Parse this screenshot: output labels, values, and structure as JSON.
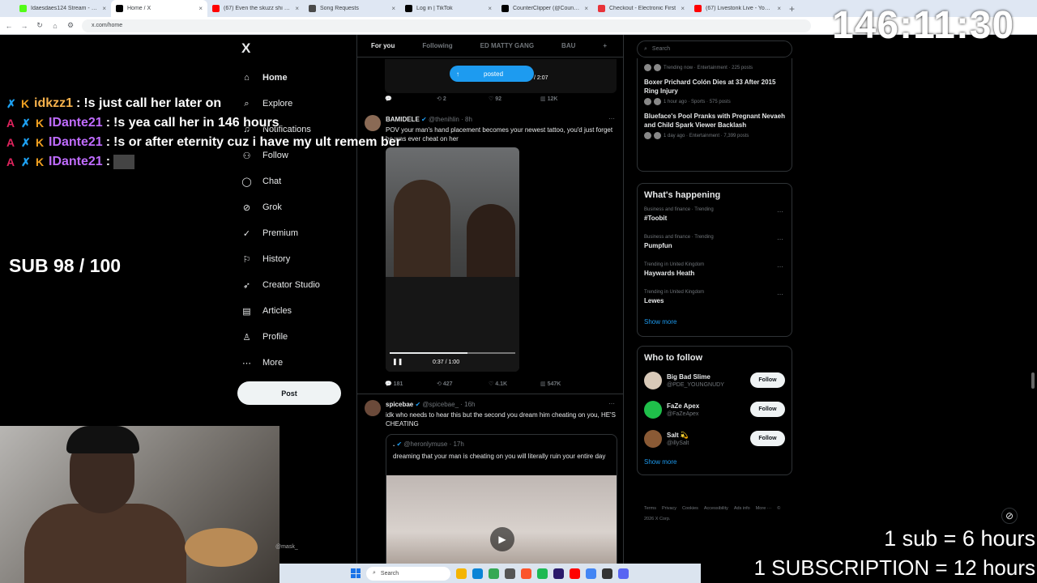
{
  "browser": {
    "tabs": [
      {
        "label": "Idaesdaes124 Stream - Watch Live",
        "color": "#53fc18",
        "active": false
      },
      {
        "label": "Home / X",
        "color": "#000000",
        "active": true
      },
      {
        "label": "(67) Even the skuzz shi goin",
        "color": "#ff0000",
        "active": false
      },
      {
        "label": "Song Requests",
        "color": "#4a4a4a",
        "active": false
      },
      {
        "label": "Log in | TikTok",
        "color": "#000000",
        "active": false
      },
      {
        "label": "CounterClipper (@CounterClip...",
        "color": "#000000",
        "active": false
      },
      {
        "label": "Checkout - Electronic First",
        "color": "#e8333a",
        "active": false
      },
      {
        "label": "(67) Livestonk Live - YouTube",
        "color": "#ff0000",
        "active": false
      }
    ],
    "new_tab": "+",
    "url": "x.com/home"
  },
  "nav": {
    "logo": "X",
    "items": [
      {
        "label": "Home",
        "icon": "home-icon",
        "glyph": "⌂",
        "active": true
      },
      {
        "label": "Explore",
        "icon": "search-icon",
        "glyph": "⌕",
        "active": false
      },
      {
        "label": "Notifications",
        "icon": "bell-icon",
        "glyph": "♫",
        "active": false
      },
      {
        "label": "Follow",
        "icon": "person-plus-icon",
        "glyph": "⚇",
        "active": false
      },
      {
        "label": "Chat",
        "icon": "chat-icon",
        "glyph": "◯",
        "active": false
      },
      {
        "label": "Grok",
        "icon": "grok-icon",
        "glyph": "⊘",
        "active": false
      },
      {
        "label": "Premium",
        "icon": "premium-icon",
        "glyph": "✓",
        "active": false
      },
      {
        "label": "History",
        "icon": "bookmark-icon",
        "glyph": "⚐",
        "active": false
      },
      {
        "label": "Creator Studio",
        "icon": "rocket-icon",
        "glyph": "➶",
        "active": false
      },
      {
        "label": "Articles",
        "icon": "articles-icon",
        "glyph": "▤",
        "active": false
      },
      {
        "label": "Profile",
        "icon": "person-icon",
        "glyph": "♙",
        "active": false
      },
      {
        "label": "More",
        "icon": "more-icon",
        "glyph": "⋯",
        "active": false
      }
    ],
    "post_label": "Post"
  },
  "timeline": {
    "tabs": [
      "For you",
      "Following",
      "ED MATTY GANG",
      "BAU",
      "+"
    ],
    "top_media": {
      "pill_label": "posted",
      "time": "/ 2:07"
    },
    "top_actions": {
      "reply": "",
      "repost": "2",
      "like": "92",
      "views": "12K"
    },
    "tweets": [
      {
        "name": "BAMIDELE",
        "handle": "@thenihlin",
        "time": "· 8h",
        "text": "POV your man's hand placement becomes your newest tattoo, you'd just forget he was ever cheat on her",
        "video": {
          "time": "0:37 / 1:00",
          "progress": 0.62
        },
        "actions": {
          "reply": "181",
          "repost": "427",
          "like": "4.1K",
          "views": "547K"
        }
      },
      {
        "name": "spicebae",
        "handle": "@spicebae_",
        "time": "· 16h",
        "text": "idk who needs to hear this but the second you dream him cheating on you, HE'S CHEATING",
        "quote": {
          "name": ".",
          "handle": "@heronlymuse",
          "time": "· 17h",
          "text": "dreaming that your man is cheating on you will literally ruin your entire day"
        }
      }
    ]
  },
  "sidebar": {
    "search_placeholder": "Search",
    "news": [
      {
        "title": "",
        "meta": "Trending now · Entertainment · 225 posts"
      },
      {
        "title": "Boxer Prichard Colón Dies at 33 After 2015 Ring Injury",
        "meta": "1 hour ago · Sports · 575 posts"
      },
      {
        "title": "Blueface's Pool Pranks with Pregnant Nevaeh and Child Spark Viewer Backlash",
        "meta": "1 day ago · Entertainment · 7,399 posts"
      }
    ],
    "happening_title": "What's happening",
    "trends": [
      {
        "meta": "Business and finance · Trending",
        "name": "#Toobit"
      },
      {
        "meta": "Business and finance · Trending",
        "name": "Pumpfun"
      },
      {
        "meta": "Trending in United Kingdom",
        "name": "Haywards Heath"
      },
      {
        "meta": "Trending in United Kingdom",
        "name": "Lewes"
      }
    ],
    "show_more": "Show more",
    "who_to_follow_title": "Who to follow",
    "follow": [
      {
        "name": "Big Bad Slime",
        "handle": "@PDE_YOUNGNUDY",
        "color": "#d8c9b8"
      },
      {
        "name": "FaZe Apex",
        "handle": "@FaZeApex",
        "color": "#1fbf4a"
      },
      {
        "name": "Salt 💫",
        "handle": "@illySalt",
        "color": "#8a5a35"
      }
    ],
    "follow_label": "Follow",
    "footer": [
      "Terms",
      "Privacy",
      "Cookies",
      "Accessibility",
      "Ads info",
      "More ···",
      "© 2026 X Corp."
    ]
  },
  "stream": {
    "timer": "146:11:30",
    "chat": [
      {
        "user": "idkzz1",
        "message": "!s just call her later on",
        "user_color": "#f5b14c"
      },
      {
        "user": "IDante21",
        "message": "!s yea call her in 146 hours",
        "user_color": "#c06cff"
      },
      {
        "user": "IDante21",
        "message": "!s or after eternity cuz i have my ult remem ber",
        "user_color": "#c06cff"
      },
      {
        "user": "IDante21",
        "message": "",
        "user_color": "#c06cff"
      }
    ],
    "sub_goal": "SUB 98 / 100",
    "sub_line1": "1 sub = 6 hours",
    "sub_line2": "1 SUBSCRIPTION = 12 hours",
    "webcam_name": "@mask_"
  },
  "taskbar": {
    "search_placeholder": "Search",
    "icons": [
      "file-explorer",
      "edge",
      "chrome",
      "store",
      "brave",
      "spotify",
      "premiere",
      "youtube",
      "chrome-alt",
      "obs",
      "discord"
    ]
  }
}
